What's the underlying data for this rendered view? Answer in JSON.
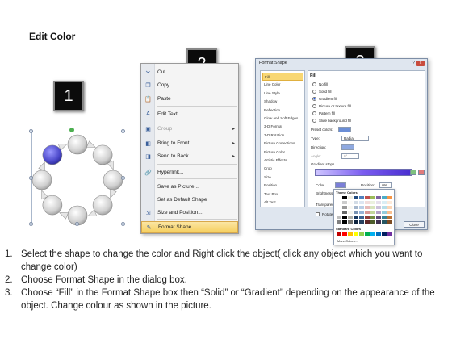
{
  "title": "Edit Color",
  "step_numbers": [
    "1",
    "2",
    "3"
  ],
  "context_menu": {
    "items": [
      {
        "label": "Cut",
        "icon": "scissors-icon",
        "glyph": "✂"
      },
      {
        "label": "Copy",
        "icon": "copy-icon",
        "glyph": "❐"
      },
      {
        "label": "Paste",
        "icon": "paste-icon",
        "glyph": "📋"
      },
      {
        "label": "Edit Text",
        "icon": "edit-text-icon",
        "glyph": "A"
      },
      {
        "label": "Group",
        "icon": "group-icon",
        "glyph": "▣",
        "disabled": true,
        "submenu": true
      },
      {
        "label": "Bring to Front",
        "icon": "bring-front-icon",
        "glyph": "◧",
        "submenu": true
      },
      {
        "label": "Send to Back",
        "icon": "send-back-icon",
        "glyph": "◨",
        "submenu": true
      },
      {
        "label": "Hyperlink...",
        "icon": "hyperlink-icon",
        "glyph": "🔗"
      },
      {
        "label": "Save as Picture...",
        "icon": "",
        "glyph": ""
      },
      {
        "label": "Set as Default Shape",
        "icon": "",
        "glyph": ""
      },
      {
        "label": "Size and Position...",
        "icon": "size-position-icon",
        "glyph": "⇲"
      },
      {
        "label": "Format Shape...",
        "icon": "format-shape-icon",
        "glyph": "✎",
        "highlight": true
      }
    ]
  },
  "dialog": {
    "title": "Format Shape",
    "help": "?",
    "close_x": "x",
    "nav": [
      "Fill",
      "Line Color",
      "Line Style",
      "Shadow",
      "Reflection",
      "Glow and Soft Edges",
      "3-D Format",
      "3-D Rotation",
      "Picture Corrections",
      "Picture Color",
      "Artistic Effects",
      "Crop",
      "Size",
      "Position",
      "Text Box",
      "Alt Text"
    ],
    "section_title": "Fill",
    "fill_options": [
      {
        "label": "No fill",
        "on": false
      },
      {
        "label": "Solid fill",
        "on": false
      },
      {
        "label": "Gradient fill",
        "on": true
      },
      {
        "label": "Picture or texture fill",
        "on": false
      },
      {
        "label": "Pattern fill",
        "on": false
      },
      {
        "label": "Slide background fill",
        "on": false
      }
    ],
    "preset_colors_label": "Preset colors:",
    "type_label": "Type:",
    "type_value": "Radial",
    "direction_label": "Direction:",
    "angle_label": "Angle:",
    "angle_value": "0°",
    "gradient_stops_label": "Gradient stops",
    "color_label": "Color",
    "position_label": "Position:",
    "position_value": "0%",
    "brightness_label": "Brightness",
    "transparency_label": "Transparency",
    "rotate_label": "Rotate with shape",
    "close_button": "Close"
  },
  "palette": {
    "theme_label": "Theme Colors",
    "standard_label": "Standard Colors",
    "more_label": "More Colors...",
    "theme_colors": [
      "#ffffff",
      "#000000",
      "#eeece1",
      "#1f497d",
      "#4f81bd",
      "#c0504d",
      "#9bbb59",
      "#8064a2",
      "#4bacc6",
      "#f79646"
    ],
    "standard_colors": [
      "#c00000",
      "#ff0000",
      "#ffc000",
      "#ffff00",
      "#92d050",
      "#00b050",
      "#00b0f0",
      "#0070c0",
      "#002060",
      "#7030a0"
    ]
  },
  "instructions": [
    {
      "num": "1.",
      "text": "Select the shape to change the color and Right click the object( click any object which you want to change color)"
    },
    {
      "num": "2.",
      "text": "Choose Format Shape in the dialog box."
    },
    {
      "num": "3.",
      "text": "Choose “Fill” in the Format Shape box then “Solid” or “Gradient” depending on the appearance of the object. Change colour as shown in the picture."
    }
  ],
  "colors": {
    "highlight": "#f6cf5e",
    "selected_circle": "#4a47c9",
    "circle": "#d8d8d8"
  }
}
